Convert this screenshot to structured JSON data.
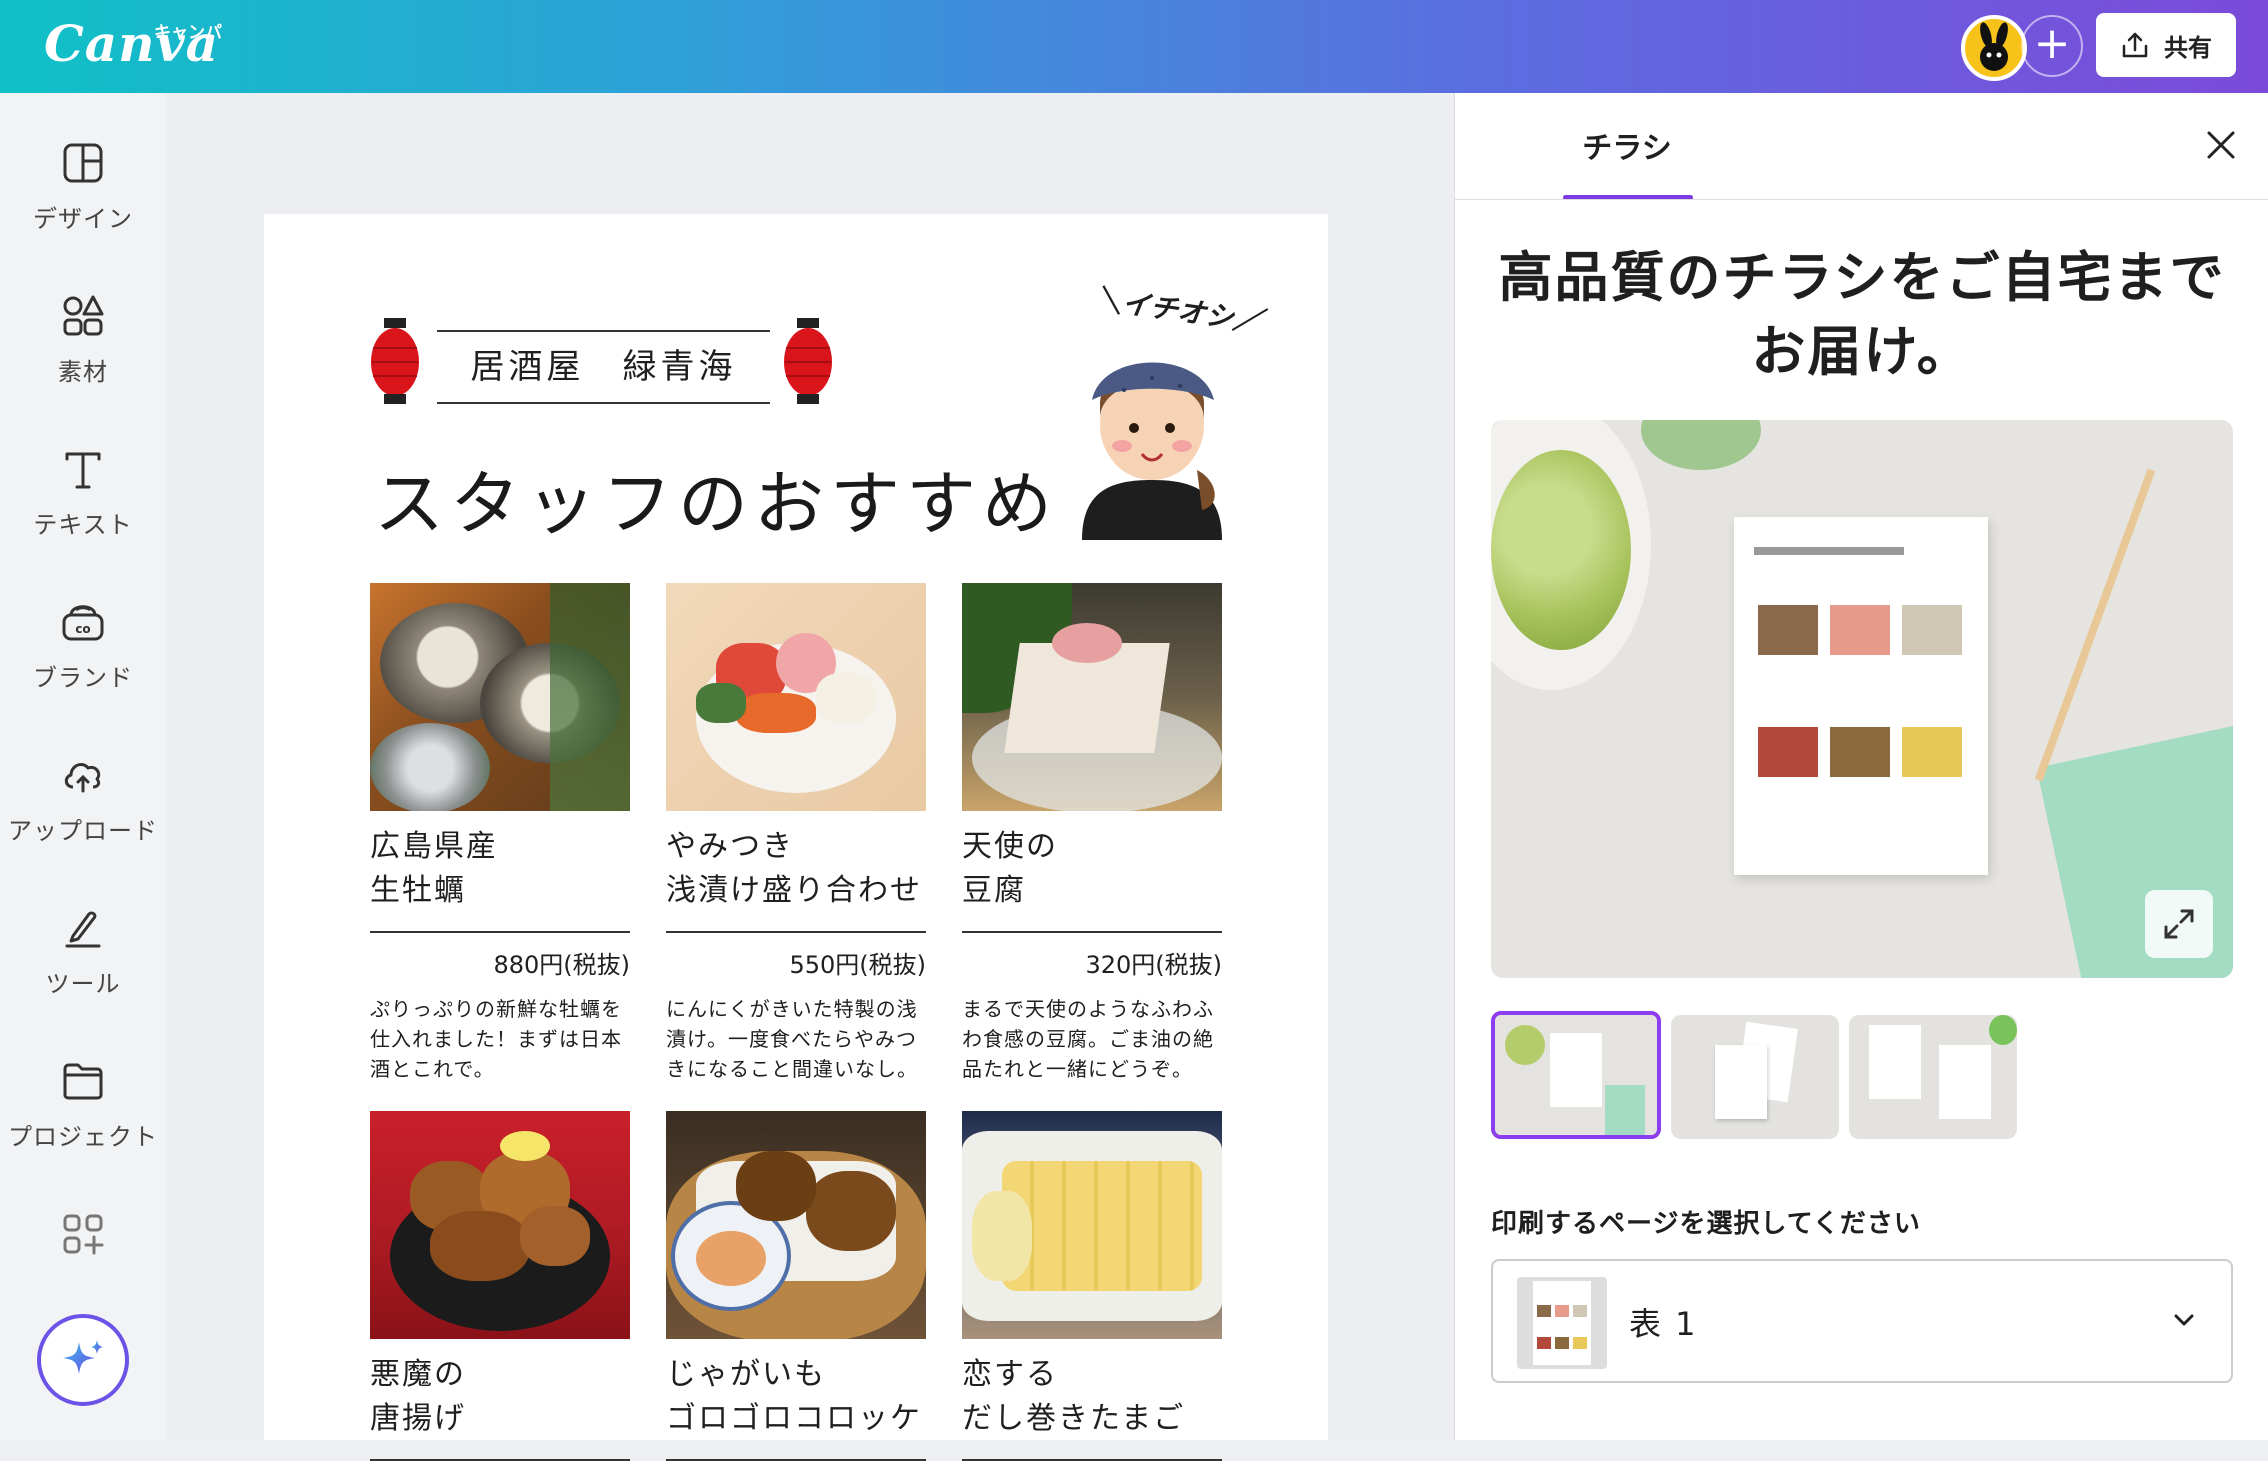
{
  "topbar": {
    "logo": "Canva",
    "logo_kana": "キャンパ",
    "share_label": "共有"
  },
  "sidebar": {
    "items": [
      {
        "label": "デザイン",
        "icon": "design-layout-icon"
      },
      {
        "label": "素材",
        "icon": "elements-shapes-icon"
      },
      {
        "label": "テキスト",
        "icon": "text-icon"
      },
      {
        "label": "ブランド",
        "icon": "brand-icon"
      },
      {
        "label": "アップロード",
        "icon": "upload-cloud-icon"
      },
      {
        "label": "ツール",
        "icon": "tools-pen-icon"
      },
      {
        "label": "プロジェクト",
        "icon": "folder-icon"
      }
    ]
  },
  "flyer": {
    "shop_name": "居酒屋　緑青海",
    "title": "スタッフのおすすめ",
    "pick_label": "イチオシ",
    "items": [
      {
        "name": "広島県産\n生牡蠣",
        "price": "880円(税抜)",
        "desc": "ぷりっぷりの新鮮な牡蠣を仕入れました！まずは日本酒とこれで。",
        "photo": "oyster-photo"
      },
      {
        "name": "やみつき\n浅漬け盛り合わせ",
        "price": "550円(税抜)",
        "desc": "にんにくがきいた特製の浅漬け。一度食べたらやみつきになること間違いなし。",
        "photo": "pickles-photo"
      },
      {
        "name": "天使の\n豆腐",
        "price": "320円(税抜)",
        "desc": "まるで天使のようなふわふわ食感の豆腐。ごま油の絶品たれと一緒にどうぞ。",
        "photo": "tofu-photo"
      },
      {
        "name": "悪魔の\n唐揚げ",
        "price": "",
        "desc": "",
        "photo": "karaage-photo"
      },
      {
        "name": "じゃがいも\nゴロゴロコロッケ",
        "price": "",
        "desc": "",
        "photo": "croquette-photo"
      },
      {
        "name": "恋する\nだし巻きたまご",
        "price": "",
        "desc": "",
        "photo": "tamagoyaki-photo"
      }
    ]
  },
  "panel": {
    "tab": "チラシ",
    "promo": "高品質のチラシをご自宅まで\nお届け。",
    "select_label": "印刷するページを選択してください",
    "page_option": "表 1"
  },
  "colors": {
    "accent": "#7d3ae6",
    "lantern": "#d9141b"
  }
}
